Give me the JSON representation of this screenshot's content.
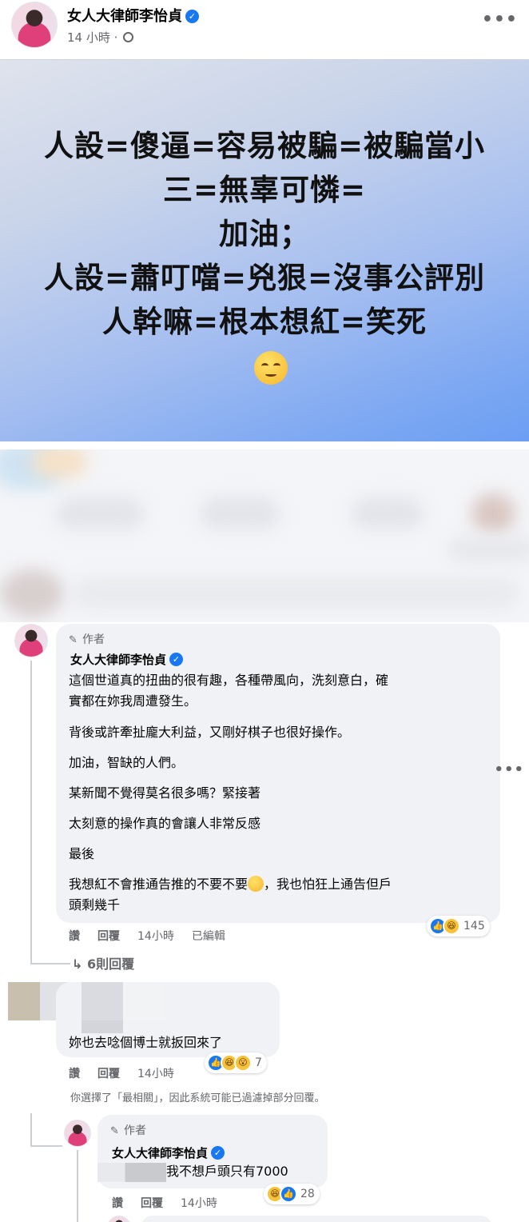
{
  "post": {
    "author": "女人大律師李怡貞",
    "time": "14 小時",
    "separator": "·",
    "image_lines": [
      "人設=傻逼=容易被騙=被騙當小",
      "三=無辜可憐=",
      "加油；",
      "人設=蕭叮噹=兇狠=沒事公評別",
      "人幹嘛=根本想紅=笑死"
    ]
  },
  "comments": {
    "first": {
      "author_tag": "作者",
      "author": "女人大律師李怡貞",
      "paragraphs": [
        "這個世道真的扭曲的很有趣，各種帶風向，洗刻意白，確",
        "實都在妳我周遭發生。",
        "背後或許牽扯龐大利益，又剛好棋子也很好操作。",
        "加油，智缺的人們。",
        "某新聞不覺得莫名很多嗎？緊接著",
        "太刻意的操作真的會讓人非常反感",
        "最後",
        "我想紅不會推通告推的不要不要",
        "，我也怕狂上通告但戶",
        "頭剩幾千"
      ],
      "actions": {
        "like": "讚",
        "reply": "回覆",
        "time": "14小時",
        "edited": "已編輯"
      },
      "reaction_count": "145",
      "replies_link": "6則回覆"
    },
    "second": {
      "text": "妳也去唸個博士就扳回來了",
      "actions": {
        "like": "讚",
        "reply": "回覆",
        "time": "14小時"
      },
      "reaction_count": "7",
      "filter_note": "你選擇了「最相關」，因此系統可能已過濾掉部分回覆。"
    },
    "third": {
      "author_tag": "作者",
      "author": "女人大律師李怡貞",
      "text": "我不想戶頭只有7000",
      "actions": {
        "like": "讚",
        "reply": "回覆",
        "time": "14小時"
      },
      "reaction_count": "28"
    }
  },
  "colors": {
    "accent": "#1877f2",
    "bubble": "#f0f2f5",
    "meta": "#65676b"
  },
  "icons": [
    "verified-icon",
    "globe-icon",
    "more-icon",
    "pen-icon",
    "like-icon",
    "haha-icon",
    "wow-icon",
    "reply-arrow-icon"
  ]
}
